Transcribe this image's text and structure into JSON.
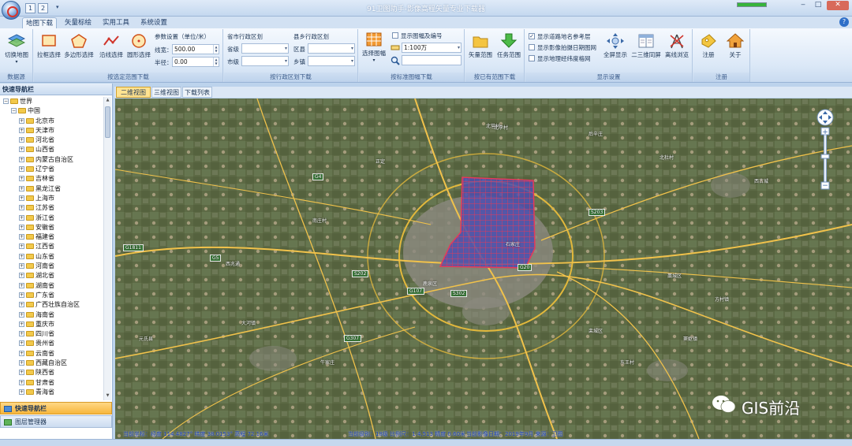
{
  "window": {
    "title": "91卫图助手-影像高程矢量专业下载器",
    "qat_buttons": [
      "1",
      "2"
    ],
    "progress": 1.0
  },
  "ribbon_tabs": [
    "地图下载",
    "矢量标绘",
    "实用工具",
    "系统设置"
  ],
  "ribbon": {
    "data_source": {
      "switch_map": "切换地图",
      "group": "数据源"
    },
    "select_range": {
      "box": "拉框选择",
      "polygon": "多边形选择",
      "polyline": "沿线选择",
      "circle": "圆形选择",
      "params_title": "参数设置（单位/米）",
      "line_width_label": "线宽：",
      "line_width_value": "500.00",
      "radius_label": "半径：",
      "radius_value": "0.00",
      "group": "按选定范围下载"
    },
    "admin_region": {
      "province_city_title": "省市行政区划",
      "county_town_title": "县乡行政区划",
      "province_label": "省级",
      "city_label": "市级",
      "county_label": "区县",
      "town_label": "乡镇",
      "group": "按行政区划下载"
    },
    "sheet": {
      "select_sheet": "选择图幅",
      "show_sheet_label": "显示图幅及编号",
      "scale_value": "1:100万",
      "group": "按标准图幅下载"
    },
    "existing": {
      "vector_range": "矢量范围",
      "task_range": "任务范围",
      "group": "按已有范围下载"
    },
    "display": {
      "chk_roadnet": "显示道路地名参考层",
      "chk_roadnet_checked": true,
      "chk_date": "显示影像拍摄日期图网",
      "chk_grid": "显示地理经纬度格网",
      "fullscreen": "全屏显示",
      "dual_screen": "二三维同屏",
      "offline": "离线浏览",
      "group": "显示设置"
    },
    "register": {
      "register": "注册",
      "about": "关于",
      "group": "注册"
    }
  },
  "left_panel": {
    "title": "快速导航栏",
    "tree": [
      {
        "label": "世界",
        "level": 0,
        "expanded": true
      },
      {
        "label": "中国",
        "level": 1,
        "expanded": true
      },
      {
        "label": "北京市",
        "level": 2
      },
      {
        "label": "天津市",
        "level": 2
      },
      {
        "label": "河北省",
        "level": 2
      },
      {
        "label": "山西省",
        "level": 2
      },
      {
        "label": "内蒙古自治区",
        "level": 2
      },
      {
        "label": "辽宁省",
        "level": 2
      },
      {
        "label": "吉林省",
        "level": 2
      },
      {
        "label": "黑龙江省",
        "level": 2
      },
      {
        "label": "上海市",
        "level": 2
      },
      {
        "label": "江苏省",
        "level": 2
      },
      {
        "label": "浙江省",
        "level": 2
      },
      {
        "label": "安徽省",
        "level": 2
      },
      {
        "label": "福建省",
        "level": 2
      },
      {
        "label": "江西省",
        "level": 2
      },
      {
        "label": "山东省",
        "level": 2
      },
      {
        "label": "河南省",
        "level": 2
      },
      {
        "label": "湖北省",
        "level": 2
      },
      {
        "label": "湖南省",
        "level": 2
      },
      {
        "label": "广东省",
        "level": 2
      },
      {
        "label": "广西壮族自治区",
        "level": 2
      },
      {
        "label": "海南省",
        "level": 2
      },
      {
        "label": "重庆市",
        "level": 2
      },
      {
        "label": "四川省",
        "level": 2
      },
      {
        "label": "贵州省",
        "level": 2
      },
      {
        "label": "云南省",
        "level": 2
      },
      {
        "label": "西藏自治区",
        "level": 2
      },
      {
        "label": "陕西省",
        "level": 2
      },
      {
        "label": "甘肃省",
        "level": 2
      },
      {
        "label": "青海省",
        "level": 2
      }
    ],
    "tabs": [
      "快速导航栏",
      "图层管理器"
    ]
  },
  "view_tabs": [
    "二维视图",
    "三维视图",
    "下载列表"
  ],
  "map": {
    "place_labels": [
      "北营村",
      "北李村",
      "南庄村",
      "后辛庄",
      "石家庄",
      "正定",
      "鹿泉区",
      "元氏县",
      "栾城区",
      "藁城区",
      "西兆通",
      "北杜村",
      "牛家庄",
      "西古城",
      "东王村",
      "大河镇",
      "方村镇",
      "窦妪镇"
    ],
    "road_labels": [
      "G4",
      "G5",
      "S202",
      "G1811",
      "G107",
      "S302",
      "G20",
      "G307",
      "S203"
    ]
  },
  "statusbar": {
    "coords": "当前坐标：经度 114.4827° 纬度 38.0153° 高程 72.16米",
    "level": "当前级别：18级 比例尺：1:4,513 精度 0.60米",
    "date": "当前影像日期：2019年9月 来源：卫图"
  },
  "watermark": "GIS前沿"
}
